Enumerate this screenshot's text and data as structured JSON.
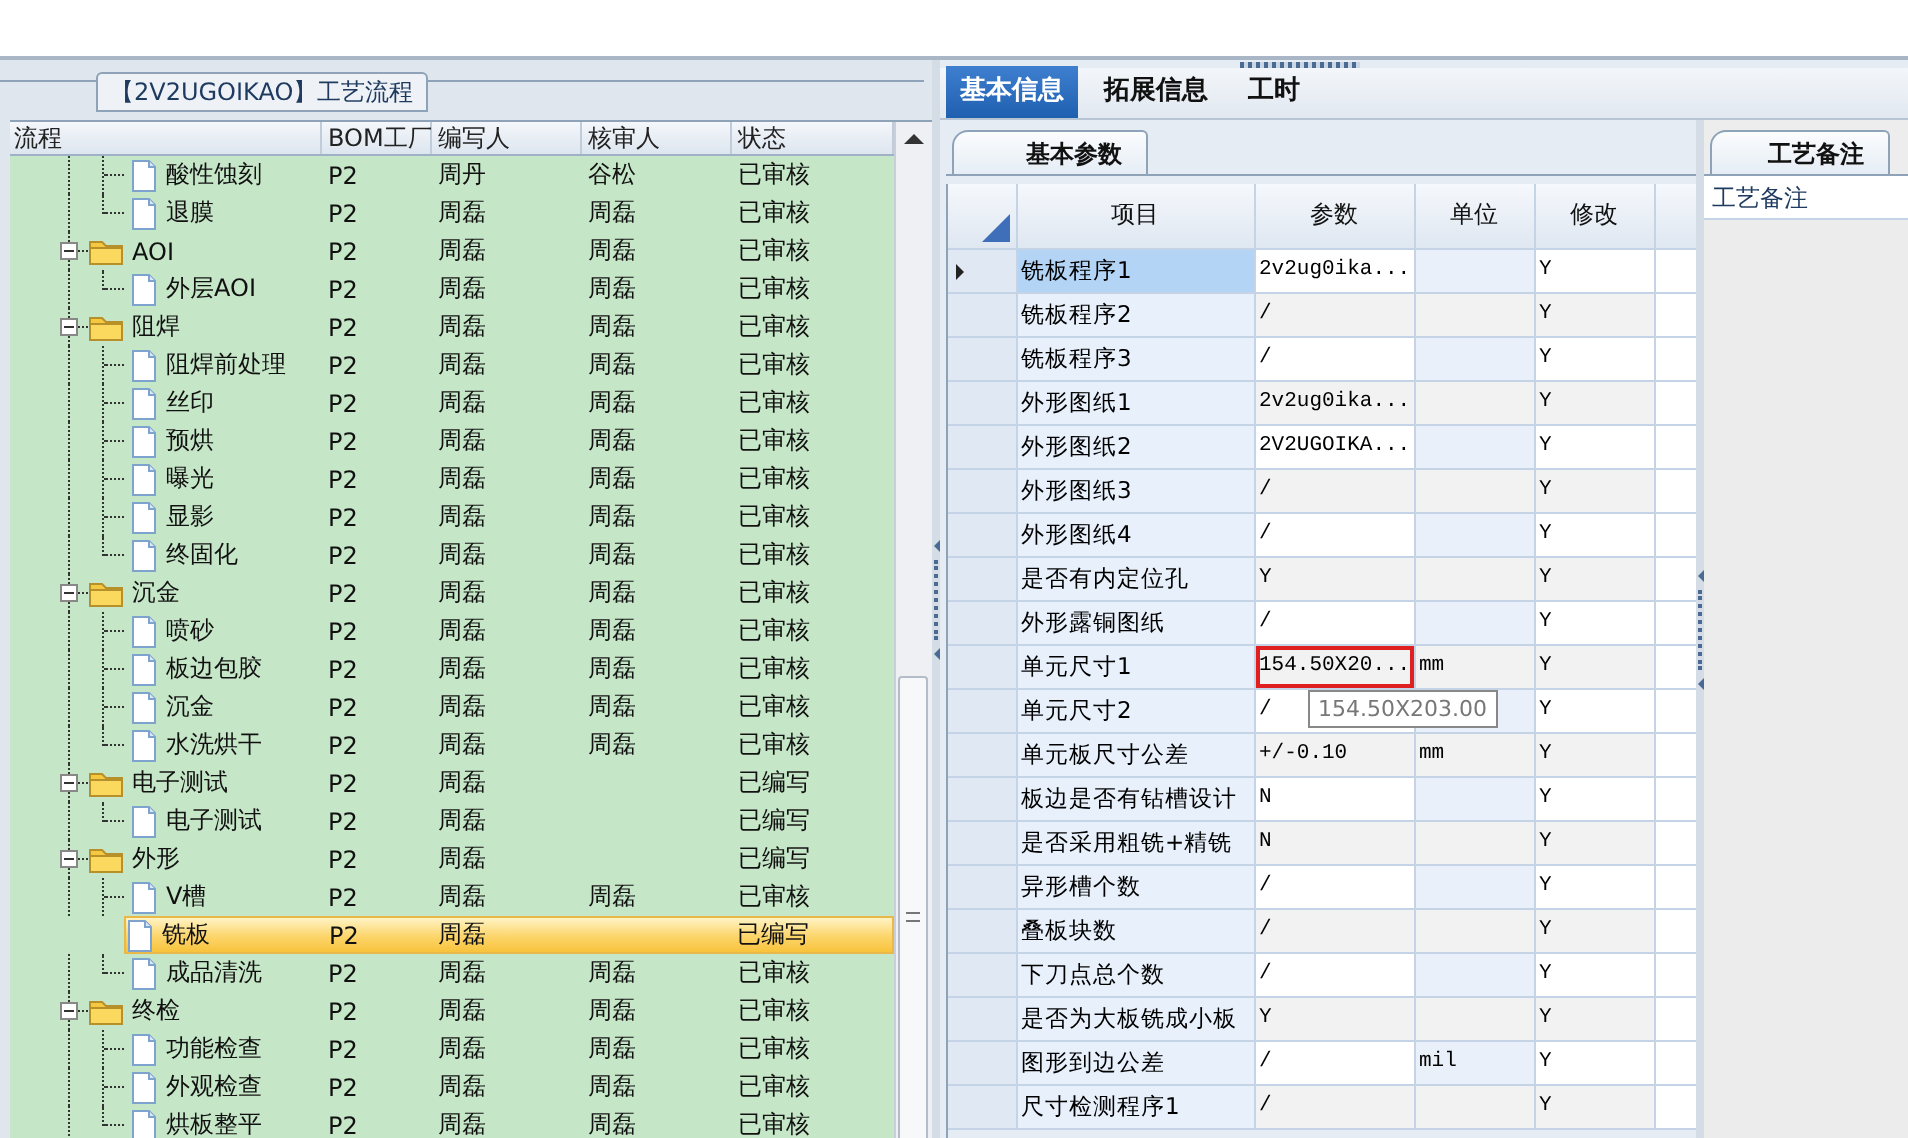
{
  "flow_panel": {
    "title": "【2V2UGOIKAO】工艺流程",
    "columns": [
      "流程",
      "BOM工厂",
      "编写人",
      "核审人",
      "状态"
    ],
    "nodes": [
      {
        "kind": "leaf",
        "label": "酸性蚀刻",
        "factory": "P2",
        "writer": "周丹",
        "reviewer": "谷松",
        "status": "已审核",
        "selected": false
      },
      {
        "kind": "leaf",
        "label": "退膜",
        "factory": "P2",
        "writer": "周磊",
        "reviewer": "周磊",
        "status": "已审核",
        "selected": false
      },
      {
        "kind": "folder",
        "label": "AOI",
        "factory": "P2",
        "writer": "周磊",
        "reviewer": "周磊",
        "status": "已审核",
        "selected": false,
        "expanded": true,
        "children": [
          {
            "kind": "leaf",
            "label": "外层AOI",
            "factory": "P2",
            "writer": "周磊",
            "reviewer": "周磊",
            "status": "已审核",
            "selected": false
          }
        ]
      },
      {
        "kind": "folder",
        "label": "阻焊",
        "factory": "P2",
        "writer": "周磊",
        "reviewer": "周磊",
        "status": "已审核",
        "selected": false,
        "expanded": true,
        "children": [
          {
            "kind": "leaf",
            "label": "阻焊前处理",
            "factory": "P2",
            "writer": "周磊",
            "reviewer": "周磊",
            "status": "已审核",
            "selected": false
          },
          {
            "kind": "leaf",
            "label": "丝印",
            "factory": "P2",
            "writer": "周磊",
            "reviewer": "周磊",
            "status": "已审核",
            "selected": false
          },
          {
            "kind": "leaf",
            "label": "预烘",
            "factory": "P2",
            "writer": "周磊",
            "reviewer": "周磊",
            "status": "已审核",
            "selected": false
          },
          {
            "kind": "leaf",
            "label": "曝光",
            "factory": "P2",
            "writer": "周磊",
            "reviewer": "周磊",
            "status": "已审核",
            "selected": false
          },
          {
            "kind": "leaf",
            "label": "显影",
            "factory": "P2",
            "writer": "周磊",
            "reviewer": "周磊",
            "status": "已审核",
            "selected": false
          },
          {
            "kind": "leaf",
            "label": "终固化",
            "factory": "P2",
            "writer": "周磊",
            "reviewer": "周磊",
            "status": "已审核",
            "selected": false
          }
        ]
      },
      {
        "kind": "folder",
        "label": "沉金",
        "factory": "P2",
        "writer": "周磊",
        "reviewer": "周磊",
        "status": "已审核",
        "selected": false,
        "expanded": true,
        "children": [
          {
            "kind": "leaf",
            "label": "喷砂",
            "factory": "P2",
            "writer": "周磊",
            "reviewer": "周磊",
            "status": "已审核",
            "selected": false
          },
          {
            "kind": "leaf",
            "label": "板边包胶",
            "factory": "P2",
            "writer": "周磊",
            "reviewer": "周磊",
            "status": "已审核",
            "selected": false
          },
          {
            "kind": "leaf",
            "label": "沉金",
            "factory": "P2",
            "writer": "周磊",
            "reviewer": "周磊",
            "status": "已审核",
            "selected": false
          },
          {
            "kind": "leaf",
            "label": "水洗烘干",
            "factory": "P2",
            "writer": "周磊",
            "reviewer": "周磊",
            "status": "已审核",
            "selected": false
          }
        ]
      },
      {
        "kind": "folder",
        "label": "电子测试",
        "factory": "P2",
        "writer": "周磊",
        "status": "已编写",
        "selected": false,
        "expanded": true,
        "children": [
          {
            "kind": "leaf",
            "label": "电子测试",
            "factory": "P2",
            "writer": "周磊",
            "status": "已编写",
            "selected": false
          }
        ]
      },
      {
        "kind": "folder",
        "label": "外形",
        "factory": "P2",
        "writer": "周磊",
        "status": "已编写",
        "selected": false,
        "expanded": true,
        "children": [
          {
            "kind": "leaf",
            "label": "V槽",
            "factory": "P2",
            "writer": "周磊",
            "reviewer": "周磊",
            "status": "已审核",
            "selected": false
          },
          {
            "kind": "leaf",
            "label": "铣板",
            "factory": "P2",
            "writer": "周磊",
            "status": "已编写",
            "selected": true
          },
          {
            "kind": "leaf",
            "label": "成品清洗",
            "factory": "P2",
            "writer": "周磊",
            "reviewer": "周磊",
            "status": "已审核",
            "selected": false
          }
        ]
      },
      {
        "kind": "folder",
        "label": "终检",
        "factory": "P2",
        "writer": "周磊",
        "reviewer": "周磊",
        "status": "已审核",
        "selected": false,
        "expanded": true,
        "children": [
          {
            "kind": "leaf",
            "label": "功能检查",
            "factory": "P2",
            "writer": "周磊",
            "reviewer": "周磊",
            "status": "已审核",
            "selected": false
          },
          {
            "kind": "leaf",
            "label": "外观检查",
            "factory": "P2",
            "writer": "周磊",
            "reviewer": "周磊",
            "status": "已审核",
            "selected": false
          },
          {
            "kind": "leaf",
            "label": "烘板整平",
            "factory": "P2",
            "writer": "周磊",
            "reviewer": "周磊",
            "status": "已审核",
            "selected": false
          }
        ]
      }
    ]
  },
  "tabs": [
    {
      "label": "基本信息",
      "selected": true
    },
    {
      "label": "拓展信息",
      "selected": false
    },
    {
      "label": "工时",
      "selected": false
    }
  ],
  "params_panel": {
    "tab": "基本参数",
    "columns": [
      "项目",
      "参数",
      "单位",
      "修改"
    ],
    "rows": [
      {
        "item": "铣板程序1",
        "value": "2v2ug0ika...",
        "modify": "Y",
        "selected": true
      },
      {
        "item": "铣板程序2",
        "value": "/",
        "modify": "Y",
        "selected": false
      },
      {
        "item": "铣板程序3",
        "value": "/",
        "modify": "Y",
        "selected": false
      },
      {
        "item": "外形图纸1",
        "value": "2v2ug0ika...",
        "modify": "Y",
        "selected": false
      },
      {
        "item": "外形图纸2",
        "value": "2V2UGOIKA...",
        "modify": "Y",
        "selected": false
      },
      {
        "item": "外形图纸3",
        "value": "/",
        "modify": "Y",
        "selected": false
      },
      {
        "item": "外形图纸4",
        "value": "/",
        "modify": "Y",
        "selected": false
      },
      {
        "item": "是否有内定位孔",
        "value": "Y",
        "modify": "Y",
        "selected": false
      },
      {
        "item": "外形露铜图纸",
        "value": "/",
        "modify": "Y",
        "selected": false
      },
      {
        "item": "单元尺寸1",
        "value": "154.50X20...",
        "unit": "mm",
        "modify": "Y",
        "selected": false,
        "marked": true
      },
      {
        "item": "单元尺寸2",
        "value": "/",
        "modify": "Y",
        "selected": false
      },
      {
        "item": "单元板尺寸公差",
        "value": "+/-0.10",
        "unit": "mm",
        "modify": "Y",
        "selected": false
      },
      {
        "item": "板边是否有钻槽设计",
        "value": "N",
        "modify": "Y",
        "selected": false
      },
      {
        "item": "是否采用粗铣+精铣",
        "value": "N",
        "modify": "Y",
        "selected": false
      },
      {
        "item": "异形槽个数",
        "value": "/",
        "modify": "Y",
        "selected": false
      },
      {
        "item": "叠板块数",
        "value": "/",
        "modify": "Y",
        "selected": false
      },
      {
        "item": "下刀点总个数",
        "value": "/",
        "modify": "Y",
        "selected": false
      },
      {
        "item": "是否为大板铣成小板",
        "value": "Y",
        "modify": "Y",
        "selected": false
      },
      {
        "item": "图形到边公差",
        "value": "/",
        "unit": "mil",
        "modify": "Y",
        "selected": false
      },
      {
        "item": "尺寸检测程序1",
        "value": "/",
        "modify": "Y",
        "selected": false
      }
    ],
    "tooltip": "154.50X203.00"
  },
  "notes_panel": {
    "tab": "工艺备注",
    "label": "工艺备注"
  }
}
